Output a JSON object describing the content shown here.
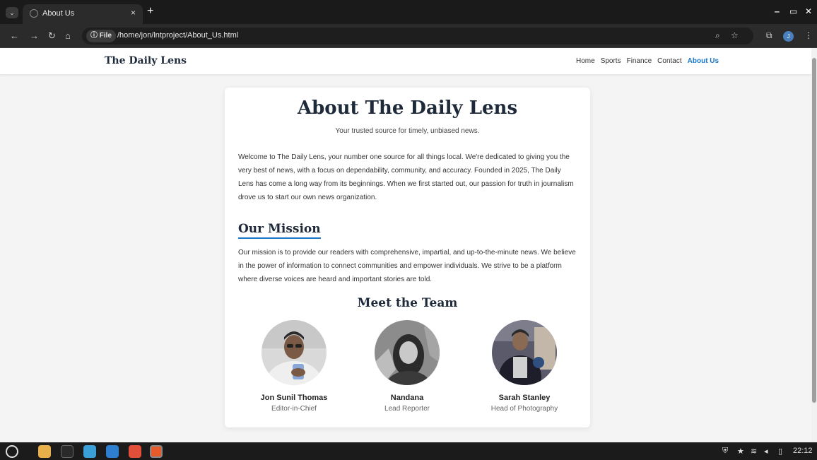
{
  "browser": {
    "tab_title": "About Us",
    "tab_close": "×",
    "new_tab": "+",
    "url_badge": "ⓘ File",
    "url": "/home/jon/lntproject/About_Us.html",
    "profile_initial": "J"
  },
  "site": {
    "brand": "The Daily Lens",
    "nav": [
      "Home",
      "Sports",
      "Finance",
      "Contact",
      "About Us"
    ],
    "active_nav": "About Us"
  },
  "about": {
    "heading": "About The Daily Lens",
    "tagline": "Your trusted source for timely, unbiased news.",
    "intro": "Welcome to The Daily Lens, your number one source for all things local. We're dedicated to giving you the very best of news, with a focus on dependability, community, and accuracy. Founded in 2025, The Daily Lens has come a long way from its beginnings. When we first started out, our passion for truth in journalism drove us to start our own news organization.",
    "mission_heading": "Our Mission",
    "mission_text": "Our mission is to provide our readers with comprehensive, impartial, and up-to-the-minute news. We believe in the power of information to connect communities and empower individuals. We strive to be a platform where diverse voices are heard and important stories are told.",
    "team_heading": "Meet the Team",
    "team": [
      {
        "name": "Jon Sunil Thomas",
        "role": "Editor-in-Chief"
      },
      {
        "name": "Nandana",
        "role": "Lead Reporter"
      },
      {
        "name": "Sarah Stanley",
        "role": "Head of Photography"
      }
    ]
  },
  "taskbar": {
    "clock": "22:12"
  },
  "colors": {
    "accent": "#1877c9",
    "heading": "#1e2a3a",
    "page_bg": "#f4f4f5"
  }
}
